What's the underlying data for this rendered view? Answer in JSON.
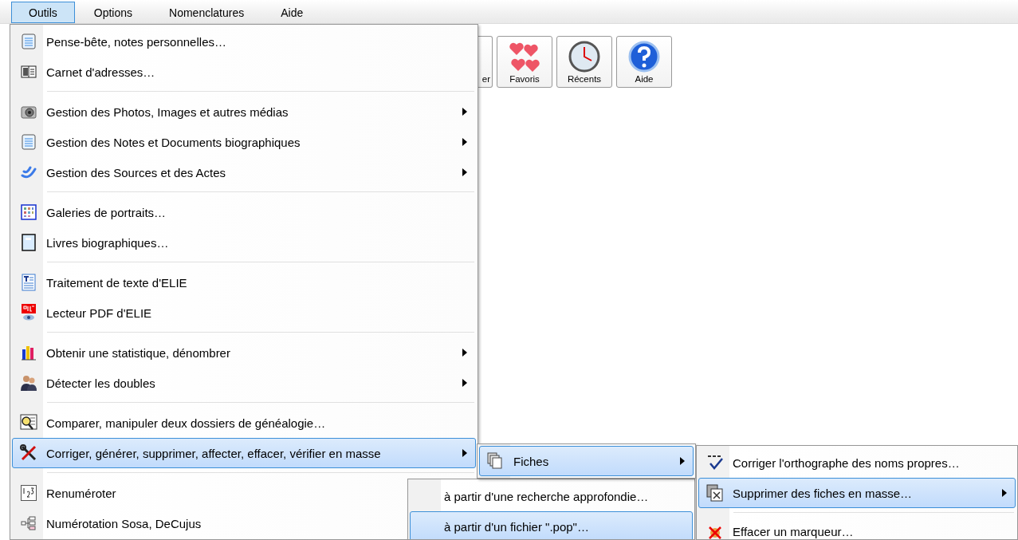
{
  "menubar": [
    {
      "label": "Outils",
      "selected": true
    },
    {
      "label": "Options",
      "selected": false
    },
    {
      "label": "Nomenclatures",
      "selected": false
    },
    {
      "label": "Aide",
      "selected": false
    }
  ],
  "toolbar": [
    {
      "label": "er"
    },
    {
      "label": "Favoris"
    },
    {
      "label": "Récents"
    },
    {
      "label": "Aide"
    }
  ],
  "menu": {
    "items": [
      {
        "kind": "item",
        "label": "Pense-bête, notes personnelles…",
        "submenu": false,
        "selected": false
      },
      {
        "kind": "item",
        "label": "Carnet d'adresses…",
        "submenu": false,
        "selected": false
      },
      {
        "kind": "separator"
      },
      {
        "kind": "item",
        "label": "Gestion des Photos, Images et autres médias",
        "submenu": true,
        "selected": false
      },
      {
        "kind": "item",
        "label": "Gestion des Notes et Documents biographiques",
        "submenu": true,
        "selected": false
      },
      {
        "kind": "item",
        "label": "Gestion des Sources et des Actes",
        "submenu": true,
        "selected": false
      },
      {
        "kind": "separator"
      },
      {
        "kind": "item",
        "label": "Galeries de portraits…",
        "submenu": false,
        "selected": false
      },
      {
        "kind": "item",
        "label": "Livres biographiques…",
        "submenu": false,
        "selected": false
      },
      {
        "kind": "separator"
      },
      {
        "kind": "item",
        "label": "Traitement de texte d'ELIE",
        "submenu": false,
        "selected": false
      },
      {
        "kind": "item",
        "label": "Lecteur PDF d'ELIE",
        "submenu": false,
        "selected": false
      },
      {
        "kind": "separator"
      },
      {
        "kind": "item",
        "label": "Obtenir une statistique, dénombrer",
        "submenu": true,
        "selected": false
      },
      {
        "kind": "item",
        "label": "Détecter les doubles",
        "submenu": true,
        "selected": false
      },
      {
        "kind": "separator"
      },
      {
        "kind": "item",
        "label": "Comparer, manipuler deux dossiers de généalogie…",
        "submenu": false,
        "selected": false
      },
      {
        "kind": "item",
        "label": "Corriger, générer, supprimer, affecter, effacer, vérifier en masse",
        "submenu": true,
        "selected": true
      },
      {
        "kind": "separator"
      },
      {
        "kind": "item",
        "label": "Renuméroter",
        "submenu": false,
        "selected": false
      },
      {
        "kind": "item",
        "label": "Numérotation Sosa, DeCujus",
        "submenu": false,
        "selected": false
      }
    ]
  },
  "submenu_fiches": {
    "items": [
      {
        "kind": "item",
        "label": "Fiches",
        "submenu": true,
        "selected": true
      }
    ]
  },
  "submenu_actions": {
    "items": [
      {
        "kind": "item",
        "label": "Corriger l'orthographe des noms propres…",
        "submenu": false,
        "selected": false
      },
      {
        "kind": "item",
        "label": "Supprimer des fiches en masse…",
        "submenu": true,
        "selected": true
      },
      {
        "kind": "separator"
      },
      {
        "kind": "item",
        "label": "Effacer un marqueur…",
        "submenu": false,
        "selected": false
      }
    ]
  },
  "submenu_source": {
    "items": [
      {
        "kind": "item",
        "label": "à partir d'une recherche approfondie…",
        "submenu": false,
        "selected": false
      },
      {
        "kind": "item",
        "label": "à partir d'un fichier \".pop\"…",
        "submenu": false,
        "selected": true
      }
    ]
  }
}
